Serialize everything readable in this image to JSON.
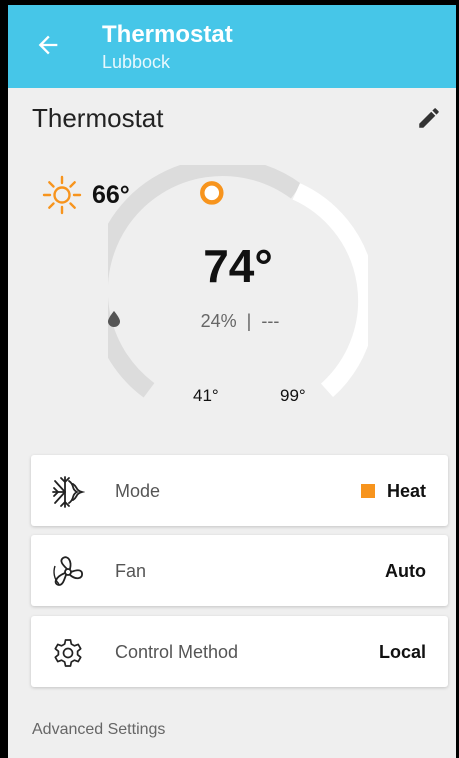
{
  "appbar": {
    "title": "Thermostat",
    "subtitle": "Lubbock",
    "back_icon": "arrow-left-icon",
    "color": "#46c6e8"
  },
  "card": {
    "title": "Thermostat",
    "edit_icon": "pencil-icon"
  },
  "outdoor": {
    "icon": "sun-icon",
    "temperature": "66°",
    "icon_color": "#f7941d"
  },
  "dial": {
    "setpoint": "74°",
    "setpoint_value": 74,
    "range_min_label": "41°",
    "range_max_label": "99°",
    "range_min": 41,
    "range_max": 99,
    "humidity_icon": "water-drop-icon",
    "humidity": "24%",
    "separator": "|",
    "secondary_reading": "---",
    "handle_color": "#f7941d",
    "track_color": "#dcdcdc",
    "active_color": "#ffffff"
  },
  "settings": {
    "mode": {
      "icon": "heat-cool-icon",
      "label": "Mode",
      "value": "Heat",
      "swatch_color": "#f7941d"
    },
    "fan": {
      "icon": "fan-icon",
      "label": "Fan",
      "value": "Auto"
    },
    "control": {
      "icon": "gear-icon",
      "label": "Control Method",
      "value": "Local"
    }
  },
  "advanced": {
    "label": "Advanced Settings"
  }
}
